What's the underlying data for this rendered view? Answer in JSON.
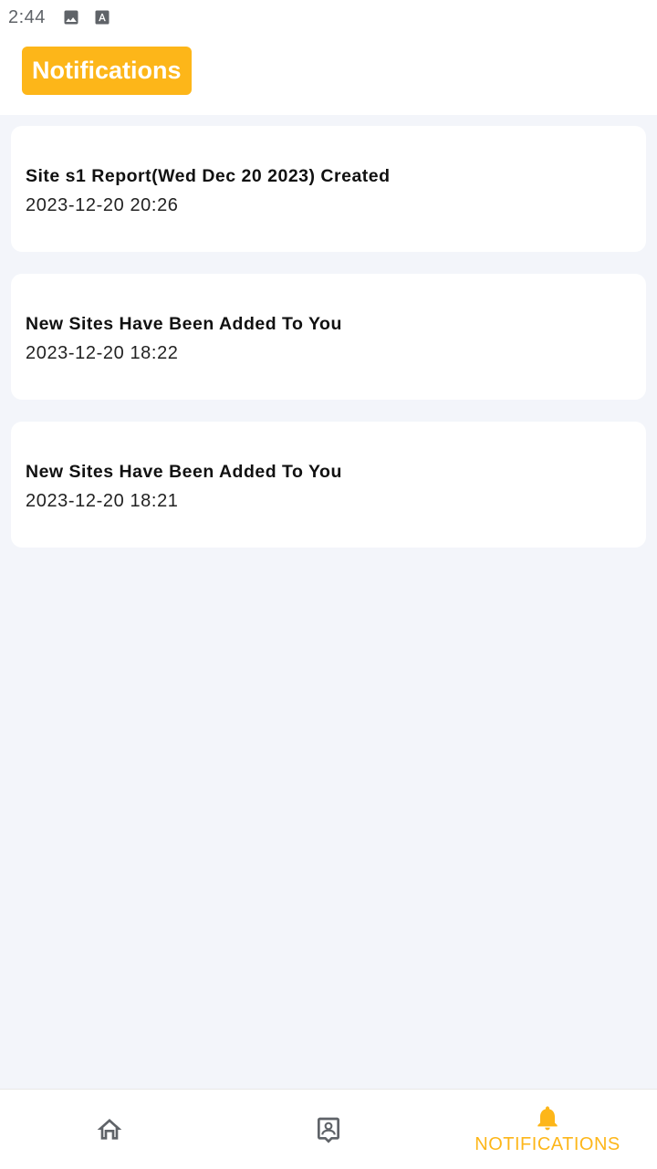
{
  "status_bar": {
    "time": "2:44",
    "icons": [
      "image-icon",
      "text-a-icon"
    ]
  },
  "header": {
    "title": "Notifications"
  },
  "notifications": [
    {
      "title": "Site s1 Report(Wed Dec 20 2023) Created",
      "time": "2023-12-20 20:26"
    },
    {
      "title": "New Sites Have Been Added To You",
      "time": "2023-12-20 18:22"
    },
    {
      "title": "New Sites Have Been Added To You",
      "time": "2023-12-20 18:21"
    }
  ],
  "bottom_nav": {
    "items": [
      {
        "icon": "home-icon",
        "label": "",
        "active": false
      },
      {
        "icon": "contact-card-icon",
        "label": "",
        "active": false
      },
      {
        "icon": "bell-icon",
        "label": "NOTIFICATIONS",
        "active": true
      }
    ]
  },
  "colors": {
    "accent": "#fdb619",
    "background": "#f3f5fa",
    "card": "#ffffff",
    "inactive_icon": "#5f6368"
  }
}
